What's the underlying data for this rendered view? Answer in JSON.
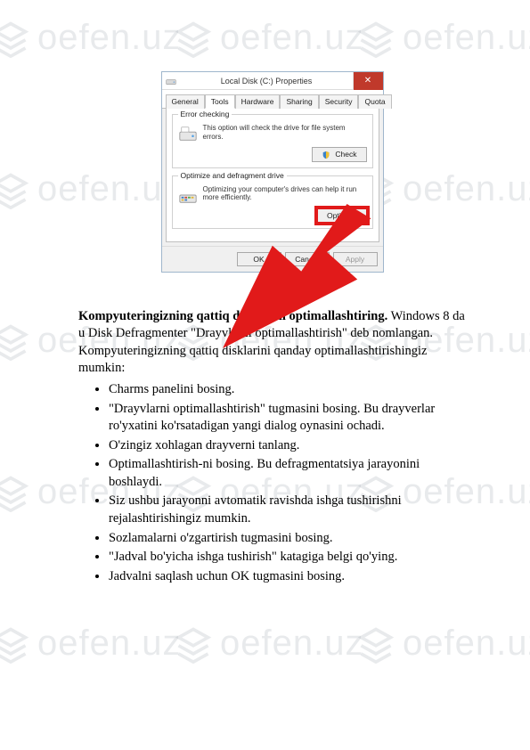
{
  "watermark": {
    "text": "oefen.uz"
  },
  "dialog": {
    "title": "Local Disk (C:) Properties",
    "close": "✕",
    "tabs": [
      "General",
      "Tools",
      "Hardware",
      "Sharing",
      "Security",
      "Quota"
    ],
    "active_tab": "Tools",
    "error_checking": {
      "title": "Error checking",
      "text": "This option will check the drive for file system errors.",
      "button": "Check"
    },
    "optimize": {
      "title": "Optimize and defragment drive",
      "text": "Optimizing your computer's drives can help it run more efficiently.",
      "button": "Optimize"
    },
    "footer": {
      "ok": "OK",
      "cancel": "Cancel",
      "apply": "Apply"
    }
  },
  "article": {
    "heading": "Kompyuteringizning qattiq disklarini optimallashtiring.",
    "intro": " Windows 8 da u Disk Defragmenter \"Drayvlarni optimallashtirish\" deb nomlangan. Kompyuteringizning qattiq disklarini qanday optimallashtirishingiz mumkin:",
    "items": [
      "Charms panelini bosing.",
      "\"Drayvlarni optimallashtirish\" tugmasini bosing. Bu drayverlar ro'yxatini ko'rsatadigan yangi dialog oynasini ochadi.",
      "O'zingiz xohlagan drayverni tanlang.",
      "Optimallashtirish-ni bosing. Bu defragmentatsiya jarayonini boshlaydi.",
      "Siz ushbu jarayonni avtomatik ravishda ishga tushirishni rejalashtirishingiz mumkin.",
      "Sozlamalarni o'zgartirish tugmasini bosing.",
      "\"Jadval bo'yicha ishga tushirish\" katagiga belgi qo'ying.",
      "Jadvalni saqlash uchun OK tugmasini bosing."
    ]
  }
}
